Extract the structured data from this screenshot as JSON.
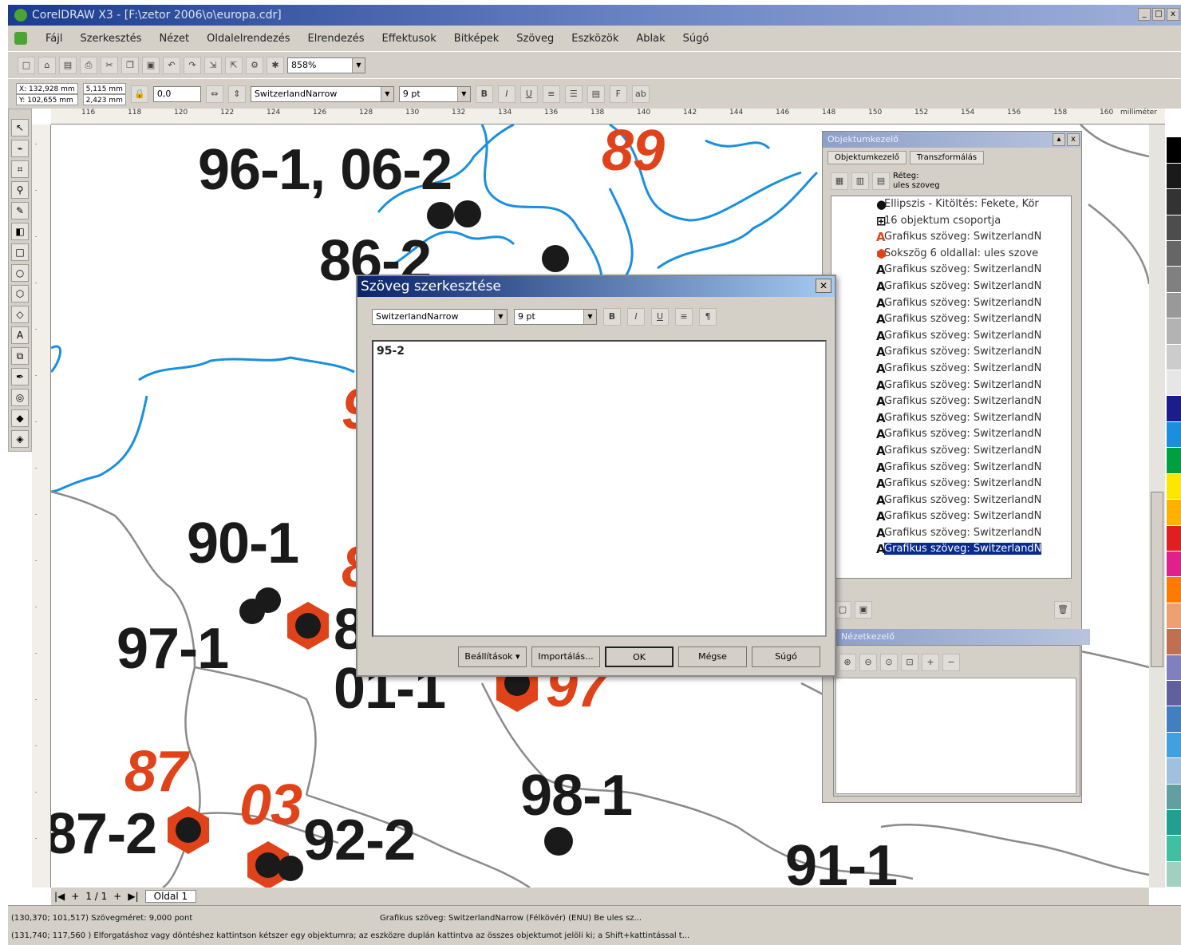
{
  "window": {
    "title": "CorelDRAW X3 - [F:\\zetor 2006\\o\\europa.cdr]",
    "controls": [
      "_",
      "□",
      "x"
    ]
  },
  "menu": [
    "Fájl",
    "Szerkesztés",
    "Nézet",
    "Oldalelrendezés",
    "Elrendezés",
    "Effektusok",
    "Bitképek",
    "Szöveg",
    "Eszközök",
    "Ablak",
    "Súgó"
  ],
  "toolbar1": {
    "zoom": "858%"
  },
  "toolbar2": {
    "x": "X: 132,928 mm",
    "y": "Y: 102,655 mm",
    "w": "5,115 mm",
    "h": "2,423 mm",
    "angle": "0,0",
    "font": "SwitzerlandNarrow",
    "size": "9 pt"
  },
  "ruler": {
    "unit": "milliméter",
    "ticks": [
      "116",
      "118",
      "120",
      "122",
      "124",
      "126",
      "128",
      "130",
      "132",
      "134",
      "136",
      "138",
      "140",
      "142",
      "144",
      "146",
      "148",
      "150",
      "152",
      "154",
      "156",
      "158",
      "160"
    ]
  },
  "map_labels": {
    "black": [
      "96-1, 06-2",
      "86-2",
      "90-1",
      "97-1",
      "01-1",
      "87-2",
      "92-2",
      "98-1",
      "91-1",
      "8"
    ],
    "red": [
      "89",
      "87",
      "03",
      "97",
      "9",
      "8"
    ]
  },
  "object_manager": {
    "title": "Objektumkezelő",
    "tabs": [
      "Objektumkezelő",
      "Transzformálás"
    ],
    "layer_label": "Réteg:",
    "layer_name": "ules szoveg",
    "items": [
      {
        "icon": "ellipse",
        "text": "Ellipszis - Kitöltés: Fekete, Kör"
      },
      {
        "icon": "group",
        "text": "16 objektum csoportja"
      },
      {
        "icon": "text-red",
        "text": "Grafikus szöveg: SwitzerlandN"
      },
      {
        "icon": "polygon",
        "text": "Sokszög 6 oldallal: ules szove"
      },
      {
        "icon": "text",
        "text": "Grafikus szöveg: SwitzerlandN"
      },
      {
        "icon": "text",
        "text": "Grafikus szöveg: SwitzerlandN"
      },
      {
        "icon": "text",
        "text": "Grafikus szöveg: SwitzerlandN"
      },
      {
        "icon": "text",
        "text": "Grafikus szöveg: SwitzerlandN"
      },
      {
        "icon": "text",
        "text": "Grafikus szöveg: SwitzerlandN"
      },
      {
        "icon": "text",
        "text": "Grafikus szöveg: SwitzerlandN"
      },
      {
        "icon": "text",
        "text": "Grafikus szöveg: SwitzerlandN"
      },
      {
        "icon": "text",
        "text": "Grafikus szöveg: SwitzerlandN"
      },
      {
        "icon": "text",
        "text": "Grafikus szöveg: SwitzerlandN"
      },
      {
        "icon": "text",
        "text": "Grafikus szöveg: SwitzerlandN"
      },
      {
        "icon": "text",
        "text": "Grafikus szöveg: SwitzerlandN"
      },
      {
        "icon": "text",
        "text": "Grafikus szöveg: SwitzerlandN"
      },
      {
        "icon": "text",
        "text": "Grafikus szöveg: SwitzerlandN"
      },
      {
        "icon": "text",
        "text": "Grafikus szöveg: SwitzerlandN"
      },
      {
        "icon": "text",
        "text": "Grafikus szöveg: SwitzerlandN"
      },
      {
        "icon": "text",
        "text": "Grafikus szöveg: SwitzerlandN"
      },
      {
        "icon": "text",
        "text": "Grafikus szöveg: SwitzerlandN"
      },
      {
        "icon": "text",
        "text": "Grafikus szöveg: SwitzerlandN",
        "selected": true
      }
    ]
  },
  "zoom_panel": {
    "title": "Nézetkezelő"
  },
  "dialog": {
    "title": "Szöveg szerkesztése",
    "font": "SwitzerlandNarrow",
    "size": "9 pt",
    "content": "95-2",
    "buttons": [
      "Beállítások ▾",
      "Importálás...",
      "OK",
      "Mégse",
      "Súgó"
    ]
  },
  "pagebar": {
    "counter": "1 / 1",
    "tab": "Oldal 1"
  },
  "status": {
    "line1_left": "(130,370; 101,517)  Szövegméret: 9,000  pont",
    "line1_mid": "Grafikus szöveg: SwitzerlandNarrow (Félkövér) (ENU) Be ules sz...",
    "line2": "(131,740; 117,560 )    Elforgatáshoz vagy döntéshez kattintson kétszer egy objektumra; az eszközre duplán kattintva az összes objektumot jelöli ki; a Shift+kattintással t..."
  },
  "colors": {
    "accent": "#0a246a",
    "map_red": "#e0431a",
    "river": "#1a8fe0",
    "border": "#8a8a8a"
  }
}
